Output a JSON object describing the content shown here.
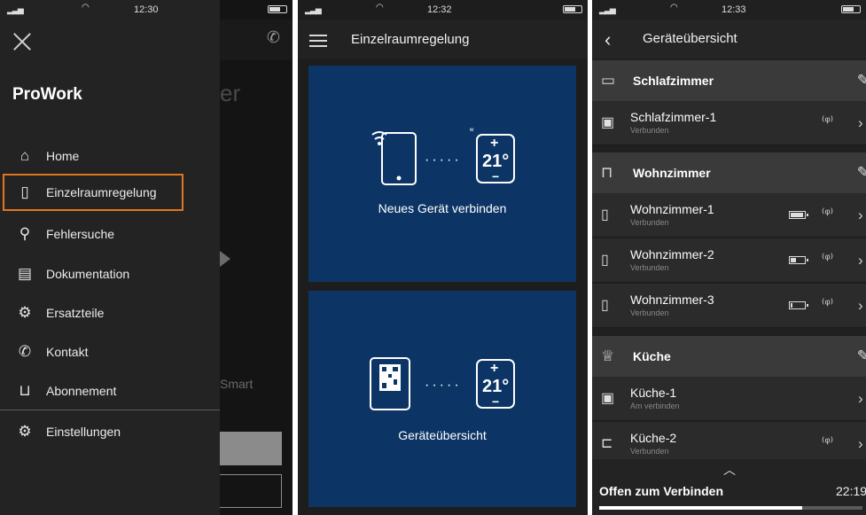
{
  "colors": {
    "accent_orange": "#e3761c",
    "tile_blue": "#0c3565",
    "dark_bg": "#1f1f1f"
  },
  "screen1": {
    "status": {
      "time": "12:30"
    },
    "brand": "ProWork",
    "menu": [
      {
        "label": "Home",
        "icon": "home-icon"
      },
      {
        "label": "Einzelraumregelung",
        "icon": "devices-icon",
        "active": true
      },
      {
        "label": "Fehlersuche",
        "icon": "search-icon"
      },
      {
        "label": "Dokumentation",
        "icon": "document-icon"
      },
      {
        "label": "Ersatzteile",
        "icon": "spare-parts-icon"
      },
      {
        "label": "Kontakt",
        "icon": "phone-icon"
      },
      {
        "label": "Abonnement",
        "icon": "cart-icon"
      },
      {
        "label": "Einstellungen",
        "icon": "gear-icon"
      }
    ],
    "background": {
      "partial_heading": "er",
      "partial_text": "Smart"
    }
  },
  "screen2": {
    "status": {
      "time": "12:32"
    },
    "title": "Einzelraumregelung",
    "tiles": [
      {
        "label": "Neues Gerät verbinden",
        "temp": "21°"
      },
      {
        "label": "Geräteübersicht",
        "temp": "21°"
      }
    ]
  },
  "screen3": {
    "status": {
      "time": "12:33"
    },
    "title": "Geräteübersicht",
    "rooms": [
      {
        "name": "Schlafzimmer",
        "devices": [
          {
            "name": "Schlafzimmer-1",
            "status": "Verbunden",
            "battery": null,
            "signal": true
          }
        ]
      },
      {
        "name": "Wohnzimmer",
        "devices": [
          {
            "name": "Wohnzimmer-1",
            "status": "Verbunden",
            "battery": 1.0,
            "signal": true
          },
          {
            "name": "Wohnzimmer-2",
            "status": "Verbunden",
            "battery": 0.4,
            "signal": true
          },
          {
            "name": "Wohnzimmer-3",
            "status": "Verbunden",
            "battery": 0.15,
            "signal": true
          }
        ]
      },
      {
        "name": "Küche",
        "devices": [
          {
            "name": "Küche-1",
            "status": "Am verbinden",
            "battery": null,
            "signal": false
          },
          {
            "name": "Küche-2",
            "status": "Verbunden",
            "battery": null,
            "signal": true
          }
        ]
      }
    ],
    "bottom": {
      "label": "Offen zum Verbinden",
      "timer": "22:19",
      "progress": 0.77
    }
  }
}
